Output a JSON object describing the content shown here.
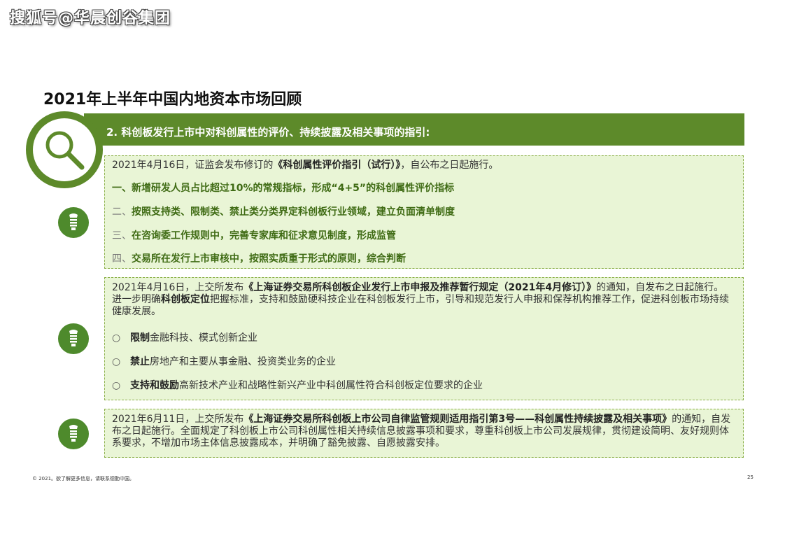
{
  "watermark": "搜狐号@华晨创谷集团",
  "title": "2021年上半年中国内地资本市场回顾",
  "header": "2. 科创板发行上市中对科创属性的评价、持续披露及相关事项的指引:",
  "box1": {
    "intro_prefix": "2021年4月16日，证监会发布修订的",
    "intro_bold": "《科创属性评价指引（试行）》",
    "intro_suffix": "，自公布之日起施行。",
    "items": [
      {
        "num": "一、",
        "text": "新增研发人员占比超过10%的常规指标，形成“4+5”的科创属性评价指标"
      },
      {
        "num": "二、",
        "text": "按照支持类、限制类、禁止类分类界定科创板行业领域，建立负面清单制度"
      },
      {
        "num": "三、",
        "text": "在咨询委工作规则中，完善专家库和征求意见制度，形成监管"
      },
      {
        "num": "四、",
        "text": "交易所在发行上市审核中，按照实质重于形式的原则，综合判断"
      }
    ]
  },
  "box2": {
    "p_prefix": "2021年4月16日，上交所发布",
    "p_bold": "《上海证券交易所科创板企业发行上市申报及推荐暂行规定（2021年4月修订）》",
    "p_mid": "的通知，自发布之日起施行。进一步明确",
    "p_bold2": "科创板定位",
    "p_suffix": "把握标准，支持和鼓励硬科技企业在科创板发行上市，引导和规范发行人申报和保荐机构推荐工作，促进科创板市场持续健康发展。",
    "bullet_mark": "○",
    "bullets": [
      {
        "bold": "限制",
        "text": "金融科技、模式创新企业"
      },
      {
        "bold": "禁止",
        "text": "房地产和主要从事金融、投资类业务的企业"
      },
      {
        "bold": "支持和鼓励",
        "text": "高新技术产业和战略性新兴产业中科创属性符合科创板定位要求的企业"
      }
    ]
  },
  "box3": {
    "p_prefix": "2021年6月11日，上交所发布",
    "p_bold": "《上海证券交易所科创板上市公司自律监管规则适用指引第3号——科创属性持续披露及相关事项》",
    "p_suffix": "的通知，自发布之日起施行。全面规定了科创板上市公司科创属性相关持续信息披露事项和要求，尊重科创板上市公司发展规律，贯彻建设简明、友好规则体系要求，不增加市场主体信息披露成本，并明确了豁免披露、自愿披露安排。"
  },
  "footer": {
    "left": "© 2021。欲了解更多信息，请联系德勤中国。",
    "page": "25"
  },
  "colors": {
    "accent": "#5d8a2a",
    "box_bg": "#e9f5d6",
    "box_border": "#8cb04a",
    "icon_bg": "#4e8a2c"
  },
  "icons": {
    "header": "magnifier-icon",
    "rows": "lightbulb-icon"
  }
}
